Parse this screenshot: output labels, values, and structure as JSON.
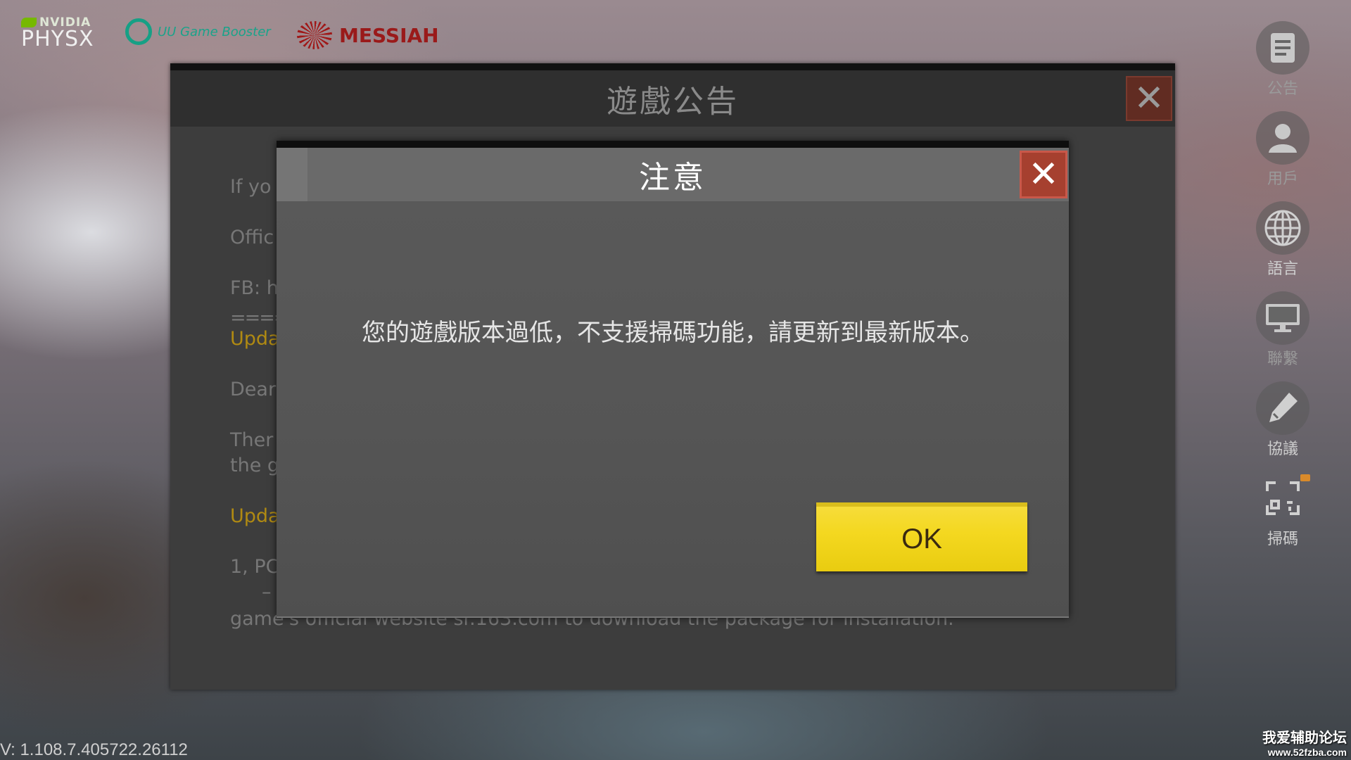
{
  "brands": {
    "nvidia_label": "NVIDIA",
    "physx_label": "PHYSX",
    "uu_label": "UU Game Booster",
    "messiah_label": "MESSIAH"
  },
  "announcement": {
    "title": "遊戲公告",
    "lines": [
      "If yo",
      "Offic",
      "FB: h",
      "=====",
      "Upda",
      "Dear",
      "Ther",
      "the g",
      "Upda",
      "1, PC",
      "–",
      "game's official website sr.163.com to download the package for installation."
    ]
  },
  "dialog": {
    "title": "注意",
    "message": "您的遊戲版本過低，不支援掃碼功能，請更新到最新版本。",
    "ok_label": "OK"
  },
  "sidebar": {
    "items": [
      {
        "label": "公告",
        "icon": "notice-icon"
      },
      {
        "label": "用戶",
        "icon": "user-icon"
      },
      {
        "label": "語言",
        "icon": "globe-icon"
      },
      {
        "label": "聯繫",
        "icon": "monitor-icon"
      },
      {
        "label": "協議",
        "icon": "pen-icon"
      },
      {
        "label": "掃碼",
        "icon": "scan-icon"
      }
    ]
  },
  "footer": {
    "version": "V: 1.108.7.405722.26112",
    "watermark_line1": "我爱辅助论坛",
    "watermark_line2": "www.52fzba.com"
  },
  "colors": {
    "ok_button": "#f4d820",
    "close_button": "#a6402f",
    "highlight_text": "#b08a12"
  }
}
